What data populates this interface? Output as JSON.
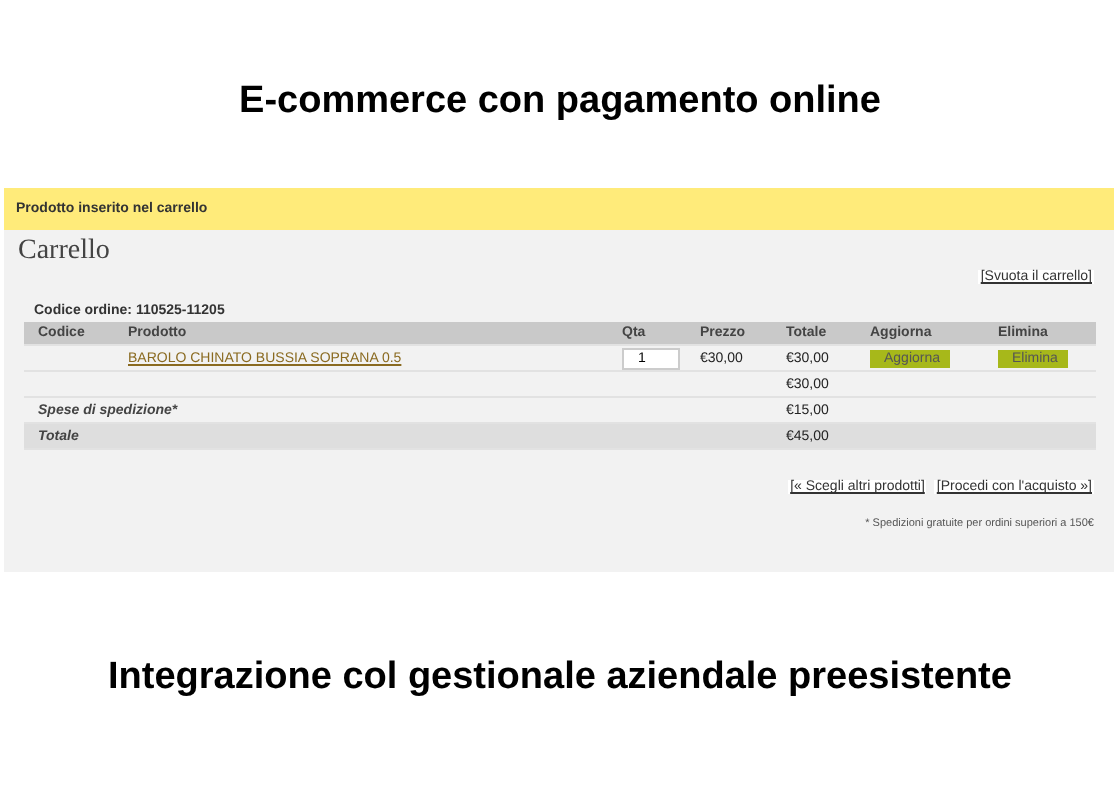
{
  "heading": "E-commerce con pagamento online",
  "notice": "Prodotto inserito nel carrello",
  "cart": {
    "title": "Carrello",
    "empty_link": "[Svuota il carrello]",
    "order_code": "Codice ordine: 110525-11205",
    "columns": [
      "Codice",
      "Prodotto",
      "Qta",
      "Prezzo",
      "Totale",
      "Aggiorna",
      "Elimina"
    ],
    "items": [
      {
        "product": "BAROLO CHINATO BUSSIA SOPRANA 0.5",
        "quantity": "1",
        "price": "€30,00",
        "total": "€30,00",
        "update": "Aggiorna",
        "remove": "Elimina"
      }
    ],
    "subtotal": "€30,00",
    "summary": [
      {
        "label": "Spese di spedizione*",
        "value": "€15,00",
        "kind": "plain"
      },
      {
        "label": "Totale",
        "value": "€45,00",
        "kind": "highlight"
      }
    ],
    "links": [
      "[« Scegli altri prodotti]",
      "[Procedi con l'acquisto »]"
    ],
    "footnote": "* Spedizioni gratuite per ordini superiori a 150€"
  },
  "caption": "Integrazione col gestionale aziendale preesistente"
}
